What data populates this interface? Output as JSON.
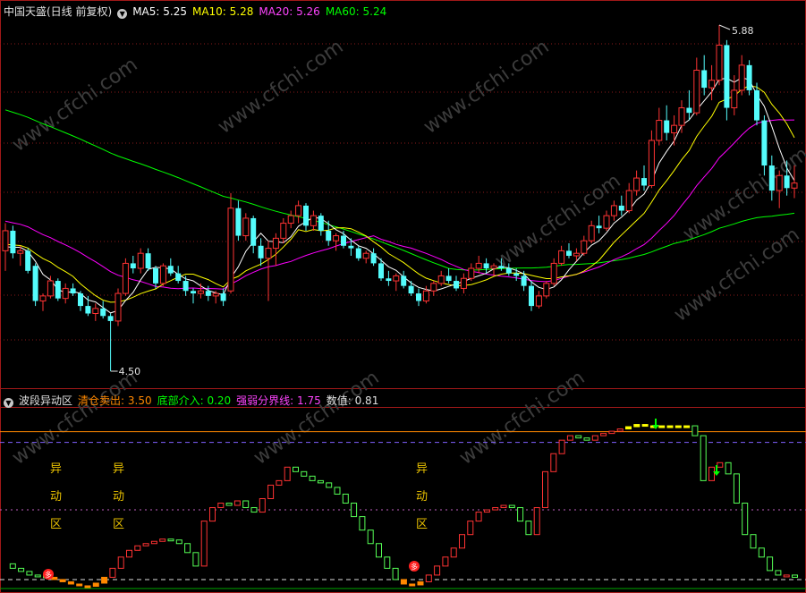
{
  "main_header": {
    "title": "中国天盛(日线 前复权)",
    "ma5": "MA5: 5.25",
    "ma10": "MA10: 5.28",
    "ma20": "MA20: 5.26",
    "ma60": "MA60: 5.24"
  },
  "sub_header": {
    "title": "波段异动区",
    "p1": "清仓卖出: 3.50",
    "p2": "底部介入: 0.20",
    "p3": "强弱分界线: 1.75",
    "p4": "数值: 0.81"
  },
  "labels": {
    "high": "5.88",
    "low": "4.50",
    "zone_chars": [
      "异",
      "动",
      "区"
    ],
    "dot_label": "多"
  },
  "watermark": "www.cfchi.com",
  "colors": {
    "up": "#ff3333",
    "down": "#54fcfc",
    "ma5": "#ffffff",
    "ma10": "#ffff00",
    "ma20": "#ff00ff",
    "ma60": "#00ff00",
    "sub_up": "#ff3333",
    "sub_down": "#55ff55",
    "yellow": "#ffff00",
    "orange": "#ff8800"
  },
  "chart_data": [
    {
      "type": "candlestick",
      "price_range": [
        4.5,
        5.88
      ],
      "candles": [
        [
          4.98,
          5.09,
          4.9,
          5.06
        ],
        [
          5.06,
          5.08,
          4.95,
          4.97
        ],
        [
          4.97,
          5.0,
          4.92,
          4.98
        ],
        [
          4.98,
          4.99,
          4.89,
          4.9
        ],
        [
          4.92,
          4.93,
          4.76,
          4.78
        ],
        [
          4.78,
          4.81,
          4.74,
          4.8
        ],
        [
          4.8,
          4.88,
          4.79,
          4.86
        ],
        [
          4.86,
          4.87,
          4.78,
          4.79
        ],
        [
          4.79,
          4.85,
          4.77,
          4.83
        ],
        [
          4.83,
          4.85,
          4.8,
          4.81
        ],
        [
          4.81,
          4.82,
          4.74,
          4.76
        ],
        [
          4.76,
          4.8,
          4.72,
          4.73
        ],
        [
          4.73,
          4.77,
          4.7,
          4.75
        ],
        [
          4.75,
          4.78,
          4.71,
          4.72
        ],
        [
          4.72,
          4.73,
          4.5,
          4.7
        ],
        [
          4.7,
          4.83,
          4.68,
          4.81
        ],
        [
          4.81,
          4.95,
          4.8,
          4.93
        ],
        [
          4.93,
          4.96,
          4.89,
          4.91
        ],
        [
          4.91,
          4.99,
          4.89,
          4.97
        ],
        [
          4.97,
          4.99,
          4.9,
          4.91
        ],
        [
          4.91,
          4.92,
          4.83,
          4.85
        ],
        [
          4.85,
          4.93,
          4.84,
          4.92
        ],
        [
          4.92,
          4.95,
          4.88,
          4.89
        ],
        [
          4.89,
          4.92,
          4.85,
          4.86
        ],
        [
          4.86,
          4.88,
          4.8,
          4.82
        ],
        [
          4.82,
          4.83,
          4.77,
          4.81
        ],
        [
          4.81,
          4.85,
          4.79,
          4.82
        ],
        [
          4.82,
          4.84,
          4.78,
          4.8
        ],
        [
          4.8,
          4.82,
          4.77,
          4.81
        ],
        [
          4.81,
          4.83,
          4.76,
          4.78
        ],
        [
          4.82,
          5.21,
          4.81,
          5.15
        ],
        [
          5.15,
          5.18,
          5.02,
          5.04
        ],
        [
          5.04,
          5.13,
          5.02,
          5.11
        ],
        [
          5.11,
          5.12,
          4.97,
          5.0
        ],
        [
          5.0,
          5.03,
          4.92,
          4.95
        ],
        [
          4.95,
          5.02,
          4.78,
          4.99
        ],
        [
          4.99,
          5.05,
          4.92,
          5.03
        ],
        [
          5.03,
          5.11,
          5.01,
          5.09
        ],
        [
          5.09,
          5.14,
          5.07,
          5.12
        ],
        [
          5.12,
          5.18,
          5.09,
          5.16
        ],
        [
          5.16,
          5.17,
          5.06,
          5.08
        ],
        [
          5.08,
          5.14,
          5.06,
          5.12
        ],
        [
          5.12,
          5.13,
          5.04,
          5.06
        ],
        [
          5.06,
          5.1,
          5.0,
          5.02
        ],
        [
          5.02,
          5.05,
          4.98,
          5.04
        ],
        [
          5.04,
          5.06,
          4.99,
          5.0
        ],
        [
          5.0,
          5.03,
          4.96,
          4.99
        ],
        [
          4.99,
          5.0,
          4.94,
          4.95
        ],
        [
          4.95,
          4.98,
          4.93,
          4.97
        ],
        [
          4.97,
          4.99,
          4.92,
          4.93
        ],
        [
          4.93,
          4.95,
          4.86,
          4.87
        ],
        [
          4.87,
          4.9,
          4.84,
          4.86
        ],
        [
          4.86,
          4.89,
          4.82,
          4.88
        ],
        [
          4.88,
          4.9,
          4.83,
          4.84
        ],
        [
          4.84,
          4.86,
          4.8,
          4.81
        ],
        [
          4.81,
          4.83,
          4.76,
          4.78
        ],
        [
          4.78,
          4.84,
          4.77,
          4.82
        ],
        [
          4.82,
          4.86,
          4.8,
          4.85
        ],
        [
          4.85,
          4.9,
          4.84,
          4.88
        ],
        [
          4.88,
          4.91,
          4.85,
          4.86
        ],
        [
          4.86,
          4.88,
          4.82,
          4.83
        ],
        [
          4.83,
          4.89,
          4.81,
          4.87
        ],
        [
          4.87,
          4.93,
          4.86,
          4.91
        ],
        [
          4.91,
          4.96,
          4.89,
          4.93
        ],
        [
          4.93,
          4.95,
          4.89,
          4.91
        ],
        [
          4.91,
          4.93,
          4.88,
          4.92
        ],
        [
          4.92,
          4.95,
          4.9,
          4.91
        ],
        [
          4.91,
          4.93,
          4.88,
          4.89
        ],
        [
          4.89,
          4.91,
          4.86,
          4.88
        ],
        [
          4.88,
          4.9,
          4.82,
          4.84
        ],
        [
          4.84,
          4.86,
          4.74,
          4.76
        ],
        [
          4.76,
          4.82,
          4.75,
          4.8
        ],
        [
          4.8,
          4.86,
          4.79,
          4.85
        ],
        [
          4.85,
          4.95,
          4.84,
          4.93
        ],
        [
          4.93,
          5.0,
          4.92,
          4.98
        ],
        [
          4.98,
          5.01,
          4.95,
          4.96
        ],
        [
          4.96,
          4.99,
          4.94,
          4.97
        ],
        [
          4.97,
          5.04,
          4.96,
          5.02
        ],
        [
          5.02,
          5.1,
          5.01,
          5.08
        ],
        [
          5.08,
          5.12,
          5.05,
          5.07
        ],
        [
          5.07,
          5.14,
          5.06,
          5.12
        ],
        [
          5.12,
          5.18,
          5.1,
          5.16
        ],
        [
          5.16,
          5.2,
          5.12,
          5.14
        ],
        [
          5.14,
          5.25,
          5.13,
          5.22
        ],
        [
          5.22,
          5.3,
          5.2,
          5.27
        ],
        [
          5.27,
          5.32,
          5.22,
          5.24
        ],
        [
          5.24,
          5.46,
          5.23,
          5.42
        ],
        [
          5.42,
          5.55,
          5.4,
          5.5
        ],
        [
          5.5,
          5.56,
          5.42,
          5.45
        ],
        [
          5.45,
          5.52,
          5.4,
          5.48
        ],
        [
          5.48,
          5.58,
          5.45,
          5.55
        ],
        [
          5.55,
          5.62,
          5.5,
          5.53
        ],
        [
          5.53,
          5.75,
          5.52,
          5.7
        ],
        [
          5.7,
          5.76,
          5.6,
          5.63
        ],
        [
          5.63,
          5.72,
          5.58,
          5.66
        ],
        [
          5.66,
          5.88,
          5.64,
          5.8
        ],
        [
          5.8,
          5.82,
          5.5,
          5.55
        ],
        [
          5.55,
          5.68,
          5.52,
          5.62
        ],
        [
          5.62,
          5.76,
          5.6,
          5.72
        ],
        [
          5.72,
          5.74,
          5.6,
          5.62
        ],
        [
          5.62,
          5.65,
          5.48,
          5.5
        ],
        [
          5.5,
          5.52,
          5.28,
          5.32
        ],
        [
          5.32,
          5.36,
          5.18,
          5.22
        ],
        [
          5.22,
          5.3,
          5.15,
          5.28
        ],
        [
          5.28,
          5.34,
          5.2,
          5.23
        ],
        [
          5.23,
          5.32,
          5.19,
          5.25
        ]
      ]
    },
    {
      "type": "bar",
      "levels": {
        "sell": 3.5,
        "buy": 0.2,
        "divider": 1.75
      },
      "current_value": 0.81,
      "value_range": [
        0,
        4.0
      ],
      "values": [
        0.55,
        0.45,
        0.38,
        0.3,
        0.28,
        0.25,
        0.2,
        0.15,
        0.1,
        0.06,
        0.05,
        0.12,
        0.25,
        0.45,
        0.7,
        0.85,
        0.95,
        1.0,
        1.05,
        1.1,
        1.08,
        1.0,
        0.8,
        0.5,
        1.5,
        1.8,
        1.9,
        1.85,
        1.95,
        1.8,
        1.7,
        2.0,
        2.3,
        2.4,
        2.7,
        2.6,
        2.5,
        2.4,
        2.35,
        2.25,
        2.1,
        1.9,
        1.6,
        1.3,
        1.0,
        0.7,
        0.45,
        0.2,
        0.1,
        0.08,
        0.15,
        0.3,
        0.5,
        0.7,
        0.9,
        1.2,
        1.5,
        1.7,
        1.75,
        1.8,
        1.85,
        1.8,
        1.5,
        1.2,
        1.8,
        2.6,
        3.0,
        3.3,
        3.4,
        3.35,
        3.3,
        3.4,
        3.45,
        3.5,
        3.55,
        3.6,
        3.65,
        3.62,
        3.62,
        3.62,
        3.62,
        3.6,
        3.62,
        3.4,
        2.4,
        2.7,
        2.8,
        2.55,
        1.9,
        1.2,
        0.9,
        0.7,
        0.4,
        0.3,
        0.3,
        0.25
      ]
    }
  ]
}
